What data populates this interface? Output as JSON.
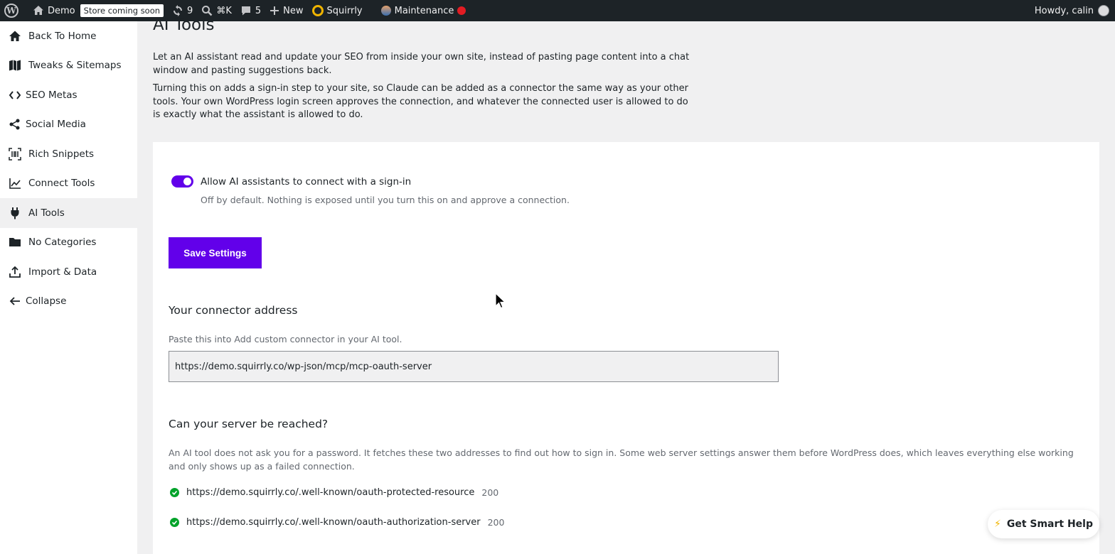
{
  "adminbar": {
    "site_name": "Demo",
    "store_badge": "Store coming soon",
    "updates_count": "9",
    "shortcut": "⌘K",
    "comments_count": "5",
    "new_label": "New",
    "squirrly_label": "Squirrly",
    "maintenance_label": "Maintenance",
    "greeting": "Howdy, calin"
  },
  "sidebar": {
    "items": [
      {
        "label": "Back To Home",
        "icon": "home-icon"
      },
      {
        "label": "Tweaks & Sitemaps",
        "icon": "map-icon"
      },
      {
        "label": "SEO Metas",
        "icon": "code-icon"
      },
      {
        "label": "Social Media",
        "icon": "share-icon"
      },
      {
        "label": "Rich Snippets",
        "icon": "barcode-icon"
      },
      {
        "label": "Connect Tools",
        "icon": "chart-icon"
      },
      {
        "label": "AI Tools",
        "icon": "plug-icon"
      },
      {
        "label": "No Categories",
        "icon": "folder-icon"
      },
      {
        "label": "Import & Data",
        "icon": "upload-icon"
      },
      {
        "label": "Collapse",
        "icon": "arrow-left-icon"
      }
    ]
  },
  "main": {
    "title": "AI Tools",
    "intro1": "Let an AI assistant read and update your SEO from inside your own site, instead of pasting page content into a chat window and pasting suggestions back.",
    "intro2": "Turning this on adds a sign-in step to your site, so Claude can be added as a connector the same way as your other tools. Your own WordPress login screen approves the connection, and whatever the connected user is allowed to do is exactly what the assistant is allowed to do.",
    "toggle_label": "Allow AI assistants to connect with a sign-in",
    "toggle_desc": "Off by default. Nothing is exposed until you turn this on and approve a connection.",
    "save_label": "Save Settings",
    "connector_title": "Your connector address",
    "connector_desc": "Paste this into Add custom connector in your AI tool.",
    "connector_value": "https://demo.squirrly.co/wp-json/mcp/mcp-oauth-server",
    "reach_title": "Can your server be reached?",
    "reach_desc": "An AI tool does not ask you for a password. It fetches these two addresses to find out how to sign in. Some web server settings answer them before WordPress does, which leaves everything else working and only shows up as a failed connection.",
    "checks": [
      {
        "url": "https://demo.squirrly.co/.well-known/oauth-protected-resource",
        "code": "200"
      },
      {
        "url": "https://demo.squirrly.co/.well-known/oauth-authorization-server",
        "code": "200"
      }
    ],
    "toggle_on": true
  },
  "help": {
    "label": "Get Smart Help"
  },
  "colors": {
    "accent": "#6200ea",
    "success": "#00a32a",
    "adminbar": "#1d2327"
  }
}
